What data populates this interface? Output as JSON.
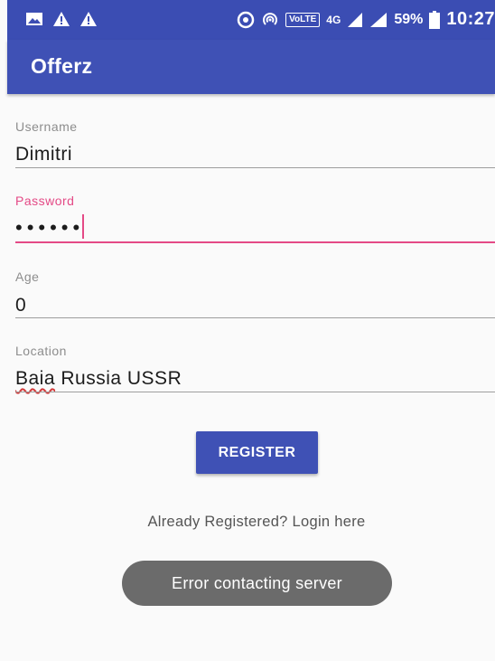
{
  "status_bar": {
    "left_icons": [
      "image-icon",
      "warning-icon",
      "warning-icon"
    ],
    "volte": "VoLTE",
    "network": "4G",
    "battery": "59%",
    "time": "10:27"
  },
  "app_bar": {
    "title": "Offerz"
  },
  "form": {
    "username": {
      "label": "Username",
      "value": "Dimitri"
    },
    "password": {
      "label": "Password",
      "value": "••••••"
    },
    "age": {
      "label": "Age",
      "value": "0"
    },
    "location": {
      "label": "Location",
      "value_misspelled": "Baia",
      "value_rest": " Russia USSR"
    }
  },
  "register_button": "REGISTER",
  "login_link": "Already Registered? Login here",
  "toast": "Error contacting server",
  "colors": {
    "primary": "#3f51b5",
    "accent": "#e44a86"
  }
}
